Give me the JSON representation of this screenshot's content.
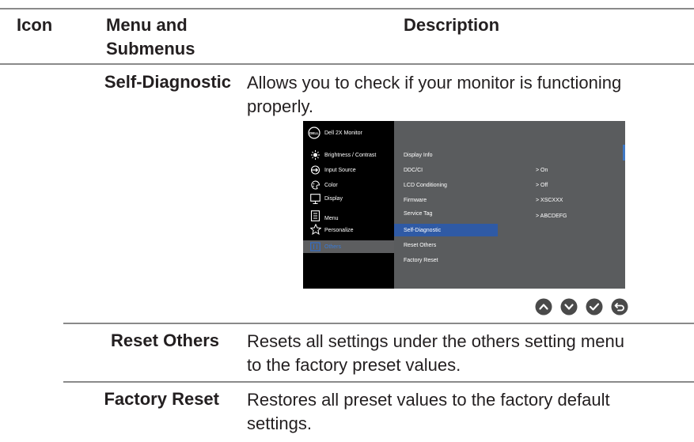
{
  "table": {
    "headers": {
      "icon": "Icon",
      "menu_line1": "Menu and",
      "menu_line2": "Submenus",
      "description": "Description"
    },
    "rows": [
      {
        "menu": "Self-Diagnostic",
        "desc_line1": "Allows you to check if your monitor is functioning",
        "desc_line2": "properly."
      },
      {
        "menu": "Reset Others",
        "desc_line1": "Resets all settings under the others setting menu",
        "desc_line2": "to the factory preset values."
      },
      {
        "menu": "Factory Reset",
        "desc_line1": "Restores all preset values to the factory default",
        "desc_line2": "settings."
      }
    ]
  },
  "osd": {
    "logo": "DELL",
    "title": "Dell 2X Monitor",
    "menu": [
      {
        "label": "Brightness / Contrast",
        "icon": "brightness-icon"
      },
      {
        "label": "Input Source",
        "icon": "input-source-icon"
      },
      {
        "label": "Color",
        "icon": "color-icon"
      },
      {
        "label": "Display",
        "icon": "display-icon"
      },
      {
        "label": "Menu",
        "icon": "menu-icon"
      },
      {
        "label": "Personalize",
        "icon": "star-icon"
      },
      {
        "label": "Others",
        "icon": "others-icon"
      }
    ],
    "items": [
      {
        "label": "Display Info",
        "value": ""
      },
      {
        "label": "DDC/CI",
        "value": ">  On"
      },
      {
        "label": "LCD Conditioning",
        "value": ">  Off"
      },
      {
        "label": "Firmware",
        "value": ">  XSCXXX"
      },
      {
        "label": "Service Tag",
        "value": ">  ABCDEFG"
      },
      {
        "label": "Self-Diagnostic",
        "value": ""
      },
      {
        "label": "Reset Others",
        "value": ""
      },
      {
        "label": "Factory Reset",
        "value": ""
      }
    ],
    "nav_buttons": [
      "up-button",
      "down-button",
      "check-button",
      "back-button"
    ],
    "colors": {
      "selected": "#2f5aa5",
      "panel": "#5a5c5e",
      "nav": "#4a4a4a"
    }
  }
}
